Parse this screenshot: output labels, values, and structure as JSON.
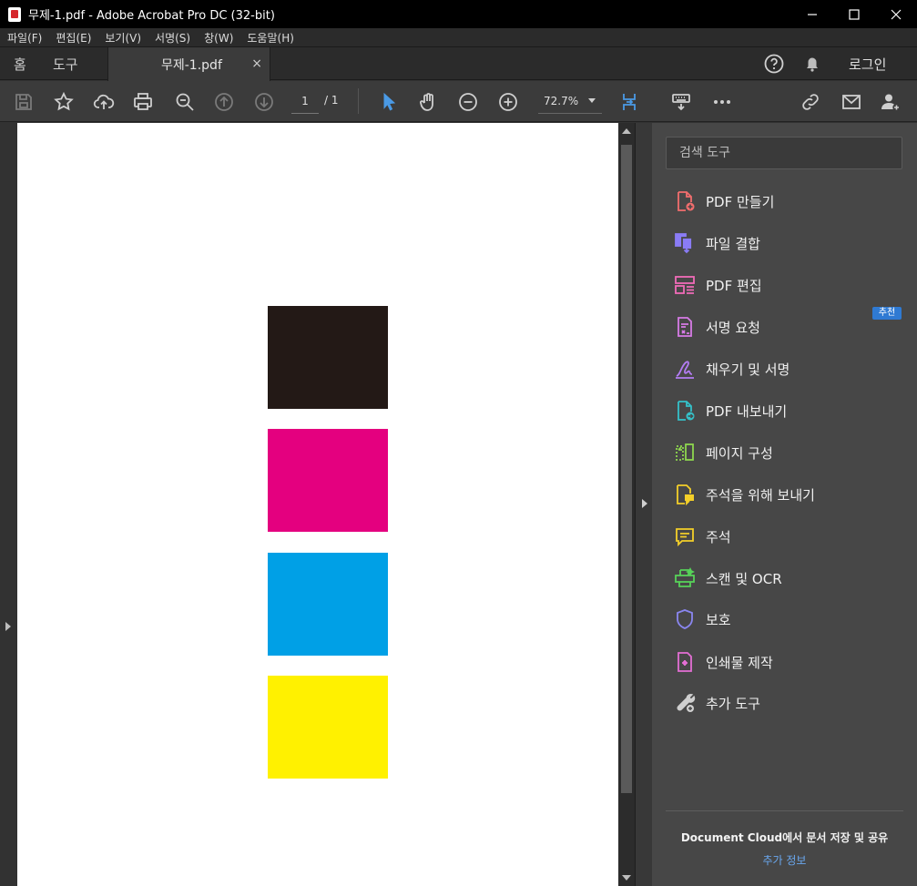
{
  "window": {
    "title": "무제-1.pdf - Adobe Acrobat Pro DC (32-bit)"
  },
  "menu": [
    "파일(F)",
    "편집(E)",
    "보기(V)",
    "서명(S)",
    "창(W)",
    "도움말(H)"
  ],
  "tabs": {
    "home": "홈",
    "tools": "도구",
    "document": "무제-1.pdf",
    "close": "×"
  },
  "account": {
    "login": "로그인"
  },
  "toolbar": {
    "page_current": "1",
    "page_of": "/  1",
    "zoom": "72.7%"
  },
  "document": {
    "swatch_colors": [
      "#231916",
      "#e4007f",
      "#00a0e6",
      "#fff100"
    ]
  },
  "tools_pane": {
    "search_placeholder": "검색 도구",
    "badge": "추천",
    "items": [
      {
        "label": "PDF 만들기",
        "icon": "create-pdf-icon",
        "color": "#f26e6e"
      },
      {
        "label": "파일 결합",
        "icon": "combine-files-icon",
        "color": "#8a7cf6"
      },
      {
        "label": "PDF 편집",
        "icon": "edit-pdf-icon",
        "color": "#f06bb8"
      },
      {
        "label": "서명 요청",
        "icon": "request-signature-icon",
        "color": "#d77be6"
      },
      {
        "label": "채우기 및 서명",
        "icon": "fill-sign-icon",
        "color": "#b37cf3"
      },
      {
        "label": "PDF 내보내기",
        "icon": "export-pdf-icon",
        "color": "#35c1c9"
      },
      {
        "label": "페이지 구성",
        "icon": "organize-pages-icon",
        "color": "#8ed64e"
      },
      {
        "label": "주석을 위해 보내기",
        "icon": "send-comments-icon",
        "color": "#f4cf29"
      },
      {
        "label": "주석",
        "icon": "comment-icon",
        "color": "#f4cf29"
      },
      {
        "label": "스캔 및 OCR",
        "icon": "scan-ocr-icon",
        "color": "#57d159"
      },
      {
        "label": "보호",
        "icon": "protect-icon",
        "color": "#8a86f0"
      },
      {
        "label": "인쇄물 제작",
        "icon": "print-production-icon",
        "color": "#e36fd4"
      },
      {
        "label": "추가 도구",
        "icon": "more-tools-icon",
        "color": "#cfcfcf"
      }
    ],
    "cloud_title": "Document Cloud에서 문서 저장 및 공유",
    "cloud_link": "추가 정보"
  }
}
